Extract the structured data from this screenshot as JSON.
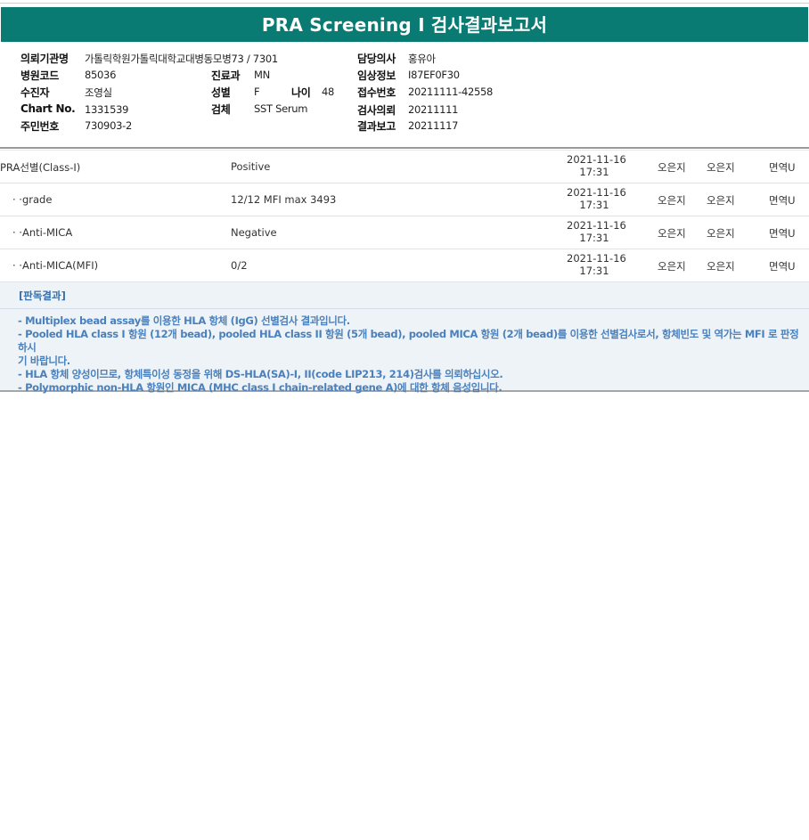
{
  "title": "PRA Screening I 검사결과보고서",
  "info": {
    "institution_label": "의뢰기관명",
    "institution_value": "가톨릭학원가톨릭대학교대병동모병73 / 7301",
    "doctor_label": "담당의사",
    "doctor_value": "홍유아",
    "hospital_code_label": "병원코드",
    "hospital_code_value": "85036",
    "dept_label": "진료과",
    "dept_value": "MN",
    "clinical_label": "임상정보",
    "clinical_value": "I87EF0F30",
    "patient_label": "수진자",
    "patient_value": "조영실",
    "sex_label": "성별",
    "sex_value": "F",
    "age_label": "나이",
    "age_value": "48",
    "receipt_label": "접수번호",
    "receipt_value": "20211111-42558",
    "chart_label": "Chart No.",
    "chart_value": "1331539",
    "specimen_label": "검체",
    "specimen_value": "SST Serum",
    "request_label": "검사의뢰",
    "request_value": "20211111",
    "resident_label": "주민번호",
    "resident_value": "730903-2",
    "report_label": "결과보고",
    "report_value": "20211117"
  },
  "results": [
    {
      "name": "PRA선별(Class-I)",
      "result": "Positive",
      "date": "2021-11-16",
      "time": "17:31",
      "person1": "오은지",
      "person2": "오은지",
      "dept": "면역U"
    },
    {
      "name": "· ·grade",
      "result": "12/12 MFI max 3493",
      "date": "2021-11-16",
      "time": "17:31",
      "person1": "오은지",
      "person2": "오은지",
      "dept": "면역U"
    },
    {
      "name": "· ·Anti-MICA",
      "result": "Negative",
      "date": "2021-11-16",
      "time": "17:31",
      "person1": "오은지",
      "person2": "오은지",
      "dept": "면역U"
    },
    {
      "name": "· ·Anti-MICA(MFI)",
      "result": "0/2",
      "date": "2021-11-16",
      "time": "17:31",
      "person1": "오은지",
      "person2": "오은지",
      "dept": "면역U"
    }
  ],
  "judgment": {
    "title": "[판독결과]",
    "lines": [
      "- Multiplex bead assay를 이용한 HLA 항체 (IgG) 선별검사 결과입니다.",
      "- Pooled HLA class I 항원 (12개 bead), pooled HLA class II 항원 (5개 bead), pooled MICA 항원 (2개 bead)를 이용한 선별검사로서, 항체빈도 및 역가는 MFI 로 판정하시",
      "기 바랍니다.",
      "- HLA 항체 양성이므로, 항체특이성 동정을 위해 DS-HLA(SA)-I, II(code LIP213, 214)검사를 의뢰하십시오.",
      "- Polymorphic non-HLA 항원인 MICA (MHC class I chain-related gene A)에 대한 항체 음성입니다."
    ]
  },
  "colors": {
    "header_bg": "#0a7b72",
    "judgment_text": "#4a80bc",
    "judgment_bg": "#eef3f8"
  }
}
